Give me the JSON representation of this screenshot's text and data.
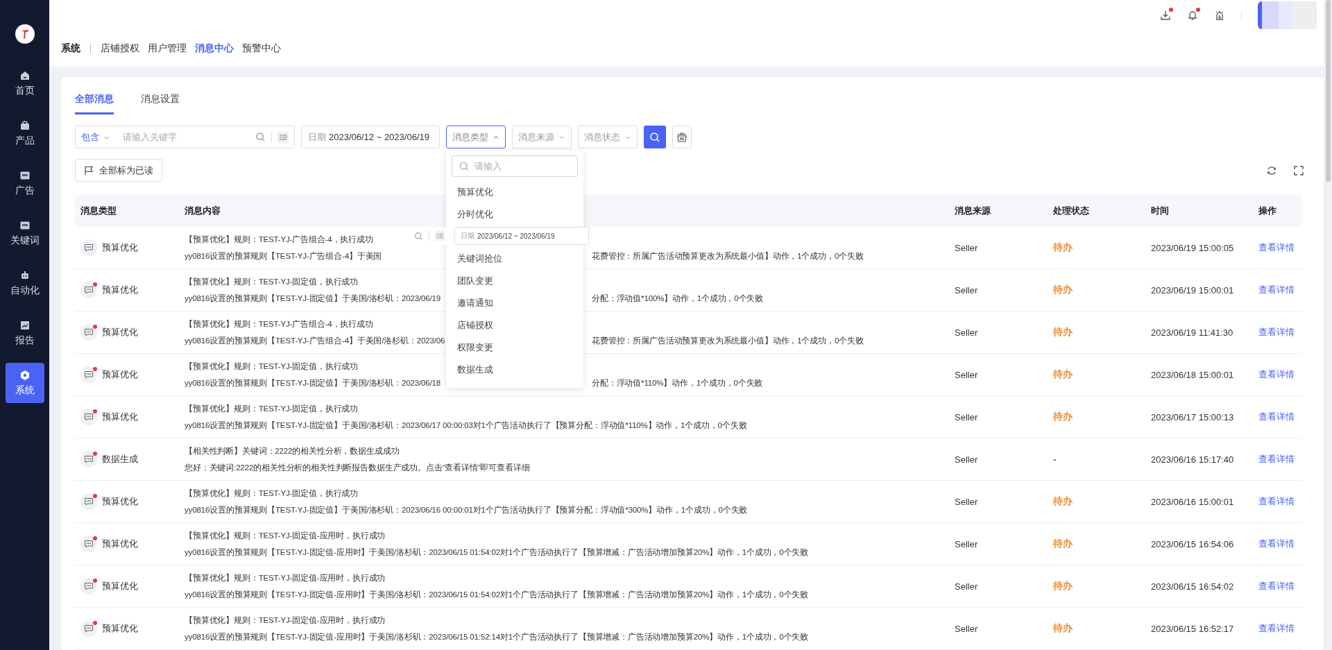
{
  "sidebar": {
    "items": [
      {
        "label": "首页",
        "selected": false
      },
      {
        "label": "产品",
        "selected": false
      },
      {
        "label": "广告",
        "selected": false
      },
      {
        "label": "关键词",
        "selected": false
      },
      {
        "label": "自动化",
        "selected": false
      },
      {
        "label": "报告",
        "selected": false
      },
      {
        "label": "系统",
        "selected": true
      }
    ]
  },
  "header": {
    "icons": [
      {
        "kind": "download",
        "badge": true
      },
      {
        "kind": "bell",
        "badge": true
      },
      {
        "kind": "alarm",
        "badge": false
      }
    ]
  },
  "breadcrumb": {
    "root": "系统",
    "items": [
      {
        "label": "店铺授权",
        "selected": false
      },
      {
        "label": "用户管理",
        "selected": false
      },
      {
        "label": "消息中心",
        "selected": true
      },
      {
        "label": "预警中心",
        "selected": false
      }
    ]
  },
  "tabs": [
    {
      "label": "全部消息",
      "selected": true
    },
    {
      "label": "消息设置",
      "selected": false
    }
  ],
  "filters": {
    "match": "包含",
    "keyword_placeholder": "请输入关键字",
    "date_label": "日期",
    "date_value": "2023/06/12 ~ 2023/06/19",
    "selects": [
      {
        "label": "消息类型",
        "expanded": true
      },
      {
        "label": "消息来源",
        "expanded": false
      },
      {
        "label": "消息状态",
        "expanded": false
      }
    ],
    "dropdown": {
      "search_placeholder": "请输入",
      "options": [
        "预算优化",
        "分时优化",
        "关键词抢位",
        "团队变更",
        "邀请通知",
        "店铺授权",
        "权限变更",
        "数据生成"
      ]
    }
  },
  "ghost_overlay": {
    "date_label": "日期",
    "date_value": "2023/06/12 ~ 2023/06/19"
  },
  "mark_all_read": "全部标为已读",
  "table": {
    "columns": [
      "消息类型",
      "消息内容",
      "消息来源",
      "处理状态",
      "时间",
      "操作"
    ],
    "rows": [
      {
        "type": "预算优化",
        "unread": false,
        "title": "【预算优化】规则：TEST-YJ-广告组合-4，执行成功",
        "detail": "yy0816设置的预算规则【TEST-YJ-广告组合-4】于美国",
        "detail_after": "花费管控：所属广告活动预算更改为系统最小值】动作，1个成功，0个失败",
        "source": "Seller",
        "status": {
          "text": "待办",
          "color": "#f08c2e"
        },
        "time": "2023/06/19 15:00:05",
        "action": "查看详情"
      },
      {
        "type": "预算优化",
        "unread": true,
        "title": "【预算优化】规则：TEST-YJ-固定值，执行成功",
        "detail": "yy0816设置的预算规则【TEST-YJ-固定值】于美国/洛杉矶：2023/06/19",
        "detail_after": "分配：浮动值*100%】动作，1个成功，0个失败",
        "source": "Seller",
        "status": {
          "text": "待办",
          "color": "#f08c2e"
        },
        "time": "2023/06/19 15:00:01",
        "action": "查看详情"
      },
      {
        "type": "预算优化",
        "unread": true,
        "title": "【预算优化】规则：TEST-YJ-广告组合-4，执行成功",
        "detail": "yy0816设置的预算规则【TEST-YJ-广告组合-4】于美国/洛杉矶：2023/06",
        "detail_after": "花费管控：所属广告活动预算更改为系统最小值】动作，1个成功，0个失败",
        "source": "Seller",
        "status": {
          "text": "待办",
          "color": "#f08c2e"
        },
        "time": "2023/06/19 11:41:30",
        "action": "查看详情"
      },
      {
        "type": "预算优化",
        "unread": true,
        "title": "【预算优化】规则：TEST-YJ-固定值，执行成功",
        "detail": "yy0816设置的预算规则【TEST-YJ-固定值】于美国/洛杉矶：2023/06/18",
        "detail_after": "分配：浮动值*110%】动作，1个成功，0个失败",
        "source": "Seller",
        "status": {
          "text": "待办",
          "color": "#f08c2e"
        },
        "time": "2023/06/18 15:00:01",
        "action": "查看详情"
      },
      {
        "type": "预算优化",
        "unread": true,
        "title": "【预算优化】规则：TEST-YJ-固定值，执行成功",
        "detail": "yy0816设置的预算规则【TEST-YJ-固定值】于美国/洛杉矶：2023/06/17 00:00:03对1个广告活动执行了【预算分配：浮动值*110%】动作，1个成功，0个失败",
        "source": "Seller",
        "status": {
          "text": "待办",
          "color": "#f08c2e"
        },
        "time": "2023/06/17 15:00:13",
        "action": "查看详情"
      },
      {
        "type": "数据生成",
        "unread": true,
        "title": "【相关性判断】关键词：2222的相关性分析，数据生成成功",
        "detail": "您好：关键词:2222的相关性分析的相关性判断报告数据生产成功。点击“查看详情”即可查看详细",
        "source": "Seller",
        "status": {
          "text": "-",
          "color": "#22a45b"
        },
        "time": "2023/06/16 15:17:40",
        "action": "查看详情"
      },
      {
        "type": "预算优化",
        "unread": true,
        "title": "【预算优化】规则：TEST-YJ-固定值，执行成功",
        "detail": "yy0816设置的预算规则【TEST-YJ-固定值】于美国/洛杉矶：2023/06/16 00:00:01对1个广告活动执行了【预算分配：浮动值*300%】动作，1个成功，0个失败",
        "source": "Seller",
        "status": {
          "text": "待办",
          "color": "#f08c2e"
        },
        "time": "2023/06/16 15:00:01",
        "action": "查看详情"
      },
      {
        "type": "预算优化",
        "unread": true,
        "title": "【预算优化】规则：TEST-YJ-固定值-应用时，执行成功",
        "detail": "yy0816设置的预算规则【TEST-YJ-固定值-应用时】于美国/洛杉矶：2023/06/15 01:54:02对1个广告活动执行了【预算增减：广告活动增加预算20%】动作，1个成功，0个失败",
        "source": "Seller",
        "status": {
          "text": "待办",
          "color": "#f08c2e"
        },
        "time": "2023/06/15 16:54:06",
        "action": "查看详情"
      },
      {
        "type": "预算优化",
        "unread": true,
        "title": "【预算优化】规则：TEST-YJ-固定值-应用时，执行成功",
        "detail": "yy0816设置的预算规则【TEST-YJ-固定值-应用时】于美国/洛杉矶：2023/06/15 01:54:02对1个广告活动执行了【预算增减：广告活动增加预算20%】动作，1个成功，0个失败",
        "source": "Seller",
        "status": {
          "text": "待办",
          "color": "#f08c2e"
        },
        "time": "2023/06/15 16:54:02",
        "action": "查看详情"
      },
      {
        "type": "预算优化",
        "unread": true,
        "title": "【预算优化】规则：TEST-YJ-固定值-应用时，执行成功",
        "detail": "yy0816设置的预算规则【TEST-YJ-固定值-应用时】于美国/洛杉矶：2023/06/15 01:52:14对1个广告活动执行了【预算增减：广告活动增加预算20%】动作，1个成功，0个失败",
        "source": "Seller",
        "status": {
          "text": "待办",
          "color": "#f08c2e"
        },
        "time": "2023/06/15 16:52:17",
        "action": "查看详情"
      }
    ]
  }
}
